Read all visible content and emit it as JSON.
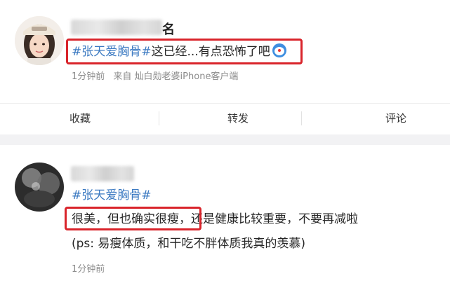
{
  "post": {
    "author_suffix": "名",
    "hashtag": "#张天爱胸骨#",
    "text": "这已经...有点恐怖了吧",
    "emoji": "doraemon-icon",
    "time": "1分钟前",
    "source": "来自 灿白勋老婆iPhone客户端"
  },
  "actions": [
    "收藏",
    "转发",
    "评论"
  ],
  "comment": {
    "hashtag": "#张天爱胸骨#",
    "highlight": "很美，但也确实很瘦，",
    "rest": "还是健康比较重要，不要再减啦",
    "line3": "(ps: 易瘦体质，和干吃不胖体质我真的羡慕)",
    "time": "1分钟前"
  },
  "colors": {
    "hashtag": "#3c7ac2",
    "highlight_box": "#d9242b",
    "page_bg": "#f2f2f4"
  }
}
